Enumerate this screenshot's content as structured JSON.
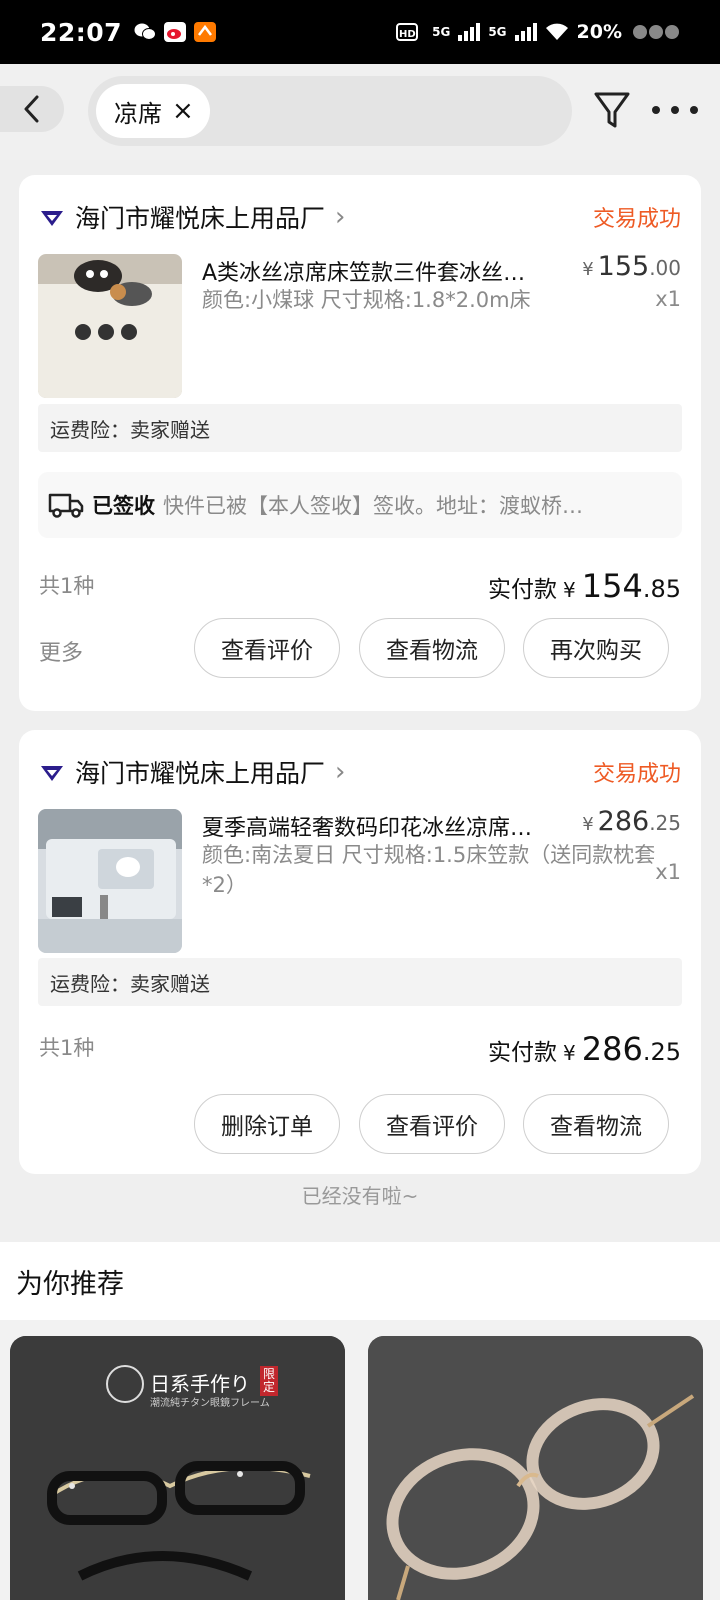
{
  "status_bar": {
    "time": "22:07",
    "network_1": "5G",
    "network_2": "5G",
    "battery": "20%",
    "icons": [
      "wechat-icon",
      "weibo-icon",
      "app-icon",
      "hd-icon",
      "signal-icon",
      "wifi-icon",
      "battery-icon"
    ]
  },
  "search": {
    "chip_text": "凉席",
    "close_glyph": "×"
  },
  "orders": [
    {
      "shop": "海门市耀悦床上用品厂",
      "status": "交易成功",
      "title": "A类冰丝凉席床笠款三件套冰丝凉席",
      "spec": "颜色:小煤球 尺寸规格:1.8*2.0m床",
      "price_currency": "¥",
      "price_int": "155",
      "price_dec": ".00",
      "qty": "x1",
      "insurance": "运费险：卖家赠送",
      "logistics_status": "已签收",
      "logistics_text": "快件已被【本人签收】签收。地址：渡蚁桥…",
      "kinds": "共1种",
      "paid_label": "实付款",
      "paid_currency": "¥",
      "paid_int": "154",
      "paid_dec": ".85",
      "more": "更多",
      "buttons": [
        "查看评价",
        "查看物流",
        "再次购买"
      ]
    },
    {
      "shop": "海门市耀悦床上用品厂",
      "status": "交易成功",
      "title": "夏季高端轻奢数码印花冰丝凉席三件套",
      "spec": "颜色:南法夏日 尺寸规格:1.5床笠款（送同款枕套*2）",
      "price_currency": "¥",
      "price_int": "286",
      "price_dec": ".25",
      "qty": "x1",
      "insurance": "运费险：卖家赠送",
      "kinds": "共1种",
      "paid_label": "实付款",
      "paid_currency": "¥",
      "paid_int": "286",
      "paid_dec": ".25",
      "buttons": [
        "删除订单",
        "查看评价",
        "查看物流"
      ]
    }
  ],
  "end_text": "已经没有啦~",
  "recommend": {
    "title": "为你推荐",
    "item1_brand": "日系手作り",
    "item1_tag": "限定",
    "item1_sub": "潮流純チタン眼鏡フレーム"
  }
}
